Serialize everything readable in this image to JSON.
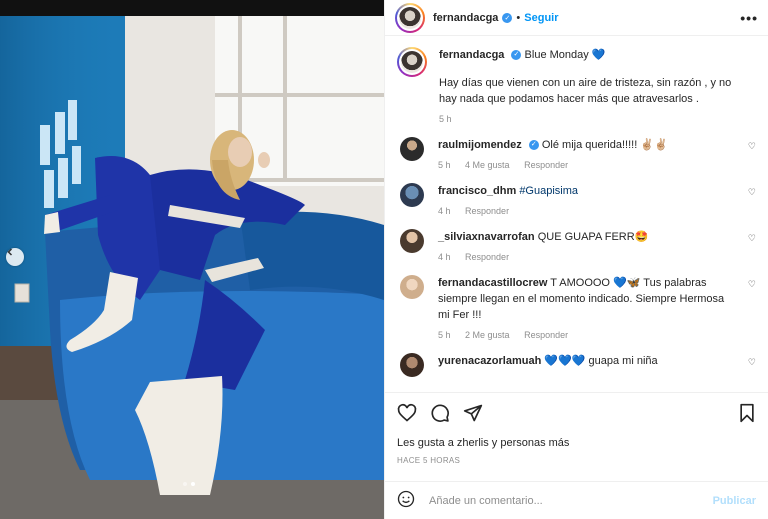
{
  "header": {
    "username": "fernandacga",
    "separator": "•",
    "follow_label": "Seguir",
    "more_icon": "more-horizontal-icon"
  },
  "caption": {
    "username": "fernandacga",
    "title": "Blue Monday",
    "heart": "💙",
    "text": "Hay días que vienen con un aire de tristeza, sin razón , y no hay nada que podamos hacer más que atravesarlos .",
    "time": "5 h"
  },
  "comments": [
    {
      "username": "raulmijomendez",
      "text": "Olé mija querida!!!!! ✌🏼✌🏼",
      "time": "5 h",
      "likes": "4 Me gusta",
      "reply": "Responder",
      "verified": true
    },
    {
      "username": "francisco_dhm",
      "text": "#Guapisima",
      "time": "4 h",
      "likes": "",
      "reply": "Responder",
      "verified": false
    },
    {
      "username": "_silviaxnavarrofan",
      "text": "QUE GUAPA FERR🤩",
      "time": "4 h",
      "likes": "",
      "reply": "Responder",
      "verified": false
    },
    {
      "username": "fernandacastillocrew",
      "text": "T AMOOOO 💙🦋 Tus palabras siempre llegan en el momento indicado. Siempre Hermosa mi Fer !!!",
      "time": "5 h",
      "likes": "2 Me gusta",
      "reply": "Responder",
      "verified": false
    },
    {
      "username": "yurenacazorlamuah",
      "text": "💙💙💙 guapa mi niña",
      "time": "",
      "likes": "",
      "reply": "",
      "verified": false
    }
  ],
  "actions": {
    "likes_text": "Les gusta a zherlis y personas más",
    "time_ago": "HACE 5 HORAS"
  },
  "composer": {
    "placeholder": "Añade un comentario...",
    "publish_label": "Publicar"
  },
  "colors": {
    "accent": "#0095f6",
    "verified": "#3897f0",
    "muted": "#8e8e8e"
  }
}
